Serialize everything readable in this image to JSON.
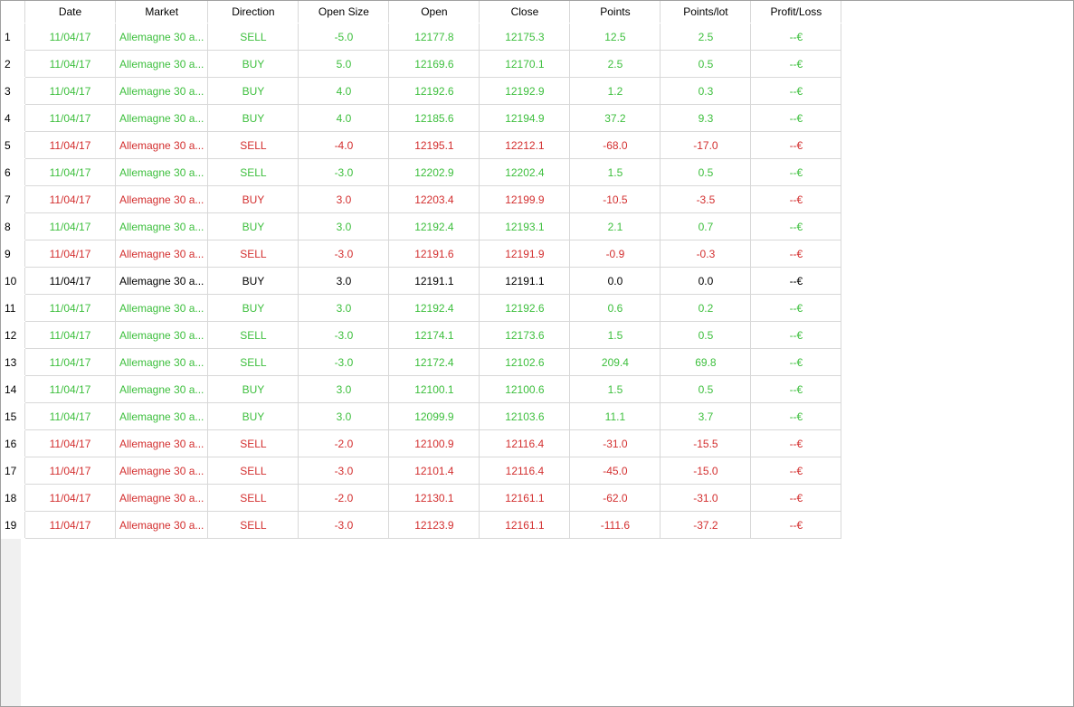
{
  "colors": {
    "win": "#3dbf3d",
    "loss": "#d32f2f",
    "neutral": "#000000"
  },
  "columns": [
    "Date",
    "Market",
    "Direction",
    "Open Size",
    "Open",
    "Close",
    "Points",
    "Points/lot",
    "Profit/Loss"
  ],
  "rows": [
    {
      "num": "1",
      "status": "win",
      "cells": [
        "11/04/17",
        "Allemagne 30 a...",
        "SELL",
        "-5.0",
        "12177.8",
        "12175.3",
        "12.5",
        "2.5",
        "--€"
      ]
    },
    {
      "num": "2",
      "status": "win",
      "cells": [
        "11/04/17",
        "Allemagne 30 a...",
        "BUY",
        "5.0",
        "12169.6",
        "12170.1",
        "2.5",
        "0.5",
        "--€"
      ]
    },
    {
      "num": "3",
      "status": "win",
      "cells": [
        "11/04/17",
        "Allemagne 30 a...",
        "BUY",
        "4.0",
        "12192.6",
        "12192.9",
        "1.2",
        "0.3",
        "--€"
      ]
    },
    {
      "num": "4",
      "status": "win",
      "cells": [
        "11/04/17",
        "Allemagne 30 a...",
        "BUY",
        "4.0",
        "12185.6",
        "12194.9",
        "37.2",
        "9.3",
        "--€"
      ]
    },
    {
      "num": "5",
      "status": "loss",
      "cells": [
        "11/04/17",
        "Allemagne 30 a...",
        "SELL",
        "-4.0",
        "12195.1",
        "12212.1",
        "-68.0",
        "-17.0",
        "--€"
      ]
    },
    {
      "num": "6",
      "status": "win",
      "cells": [
        "11/04/17",
        "Allemagne 30 a...",
        "SELL",
        "-3.0",
        "12202.9",
        "12202.4",
        "1.5",
        "0.5",
        "--€"
      ]
    },
    {
      "num": "7",
      "status": "loss",
      "cells": [
        "11/04/17",
        "Allemagne 30 a...",
        "BUY",
        "3.0",
        "12203.4",
        "12199.9",
        "-10.5",
        "-3.5",
        "--€"
      ]
    },
    {
      "num": "8",
      "status": "win",
      "cells": [
        "11/04/17",
        "Allemagne 30 a...",
        "BUY",
        "3.0",
        "12192.4",
        "12193.1",
        "2.1",
        "0.7",
        "--€"
      ]
    },
    {
      "num": "9",
      "status": "loss",
      "cells": [
        "11/04/17",
        "Allemagne 30 a...",
        "SELL",
        "-3.0",
        "12191.6",
        "12191.9",
        "-0.9",
        "-0.3",
        "--€"
      ]
    },
    {
      "num": "10",
      "status": "neutral",
      "cells": [
        "11/04/17",
        "Allemagne 30 a...",
        "BUY",
        "3.0",
        "12191.1",
        "12191.1",
        "0.0",
        "0.0",
        "--€"
      ]
    },
    {
      "num": "11",
      "status": "win",
      "cells": [
        "11/04/17",
        "Allemagne 30 a...",
        "BUY",
        "3.0",
        "12192.4",
        "12192.6",
        "0.6",
        "0.2",
        "--€"
      ]
    },
    {
      "num": "12",
      "status": "win",
      "cells": [
        "11/04/17",
        "Allemagne 30 a...",
        "SELL",
        "-3.0",
        "12174.1",
        "12173.6",
        "1.5",
        "0.5",
        "--€"
      ]
    },
    {
      "num": "13",
      "status": "win",
      "cells": [
        "11/04/17",
        "Allemagne 30 a...",
        "SELL",
        "-3.0",
        "12172.4",
        "12102.6",
        "209.4",
        "69.8",
        "--€"
      ]
    },
    {
      "num": "14",
      "status": "win",
      "cells": [
        "11/04/17",
        "Allemagne 30 a...",
        "BUY",
        "3.0",
        "12100.1",
        "12100.6",
        "1.5",
        "0.5",
        "--€"
      ]
    },
    {
      "num": "15",
      "status": "win",
      "cells": [
        "11/04/17",
        "Allemagne 30 a...",
        "BUY",
        "3.0",
        "12099.9",
        "12103.6",
        "11.1",
        "3.7",
        "--€"
      ]
    },
    {
      "num": "16",
      "status": "loss",
      "cells": [
        "11/04/17",
        "Allemagne 30 a...",
        "SELL",
        "-2.0",
        "12100.9",
        "12116.4",
        "-31.0",
        "-15.5",
        "--€"
      ]
    },
    {
      "num": "17",
      "status": "loss",
      "cells": [
        "11/04/17",
        "Allemagne 30 a...",
        "SELL",
        "-3.0",
        "12101.4",
        "12116.4",
        "-45.0",
        "-15.0",
        "--€"
      ]
    },
    {
      "num": "18",
      "status": "loss",
      "cells": [
        "11/04/17",
        "Allemagne 30 a...",
        "SELL",
        "-2.0",
        "12130.1",
        "12161.1",
        "-62.0",
        "-31.0",
        "--€"
      ]
    },
    {
      "num": "19",
      "status": "loss",
      "cells": [
        "11/04/17",
        "Allemagne 30 a...",
        "SELL",
        "-3.0",
        "12123.9",
        "12161.1",
        "-111.6",
        "-37.2",
        "--€"
      ]
    }
  ]
}
